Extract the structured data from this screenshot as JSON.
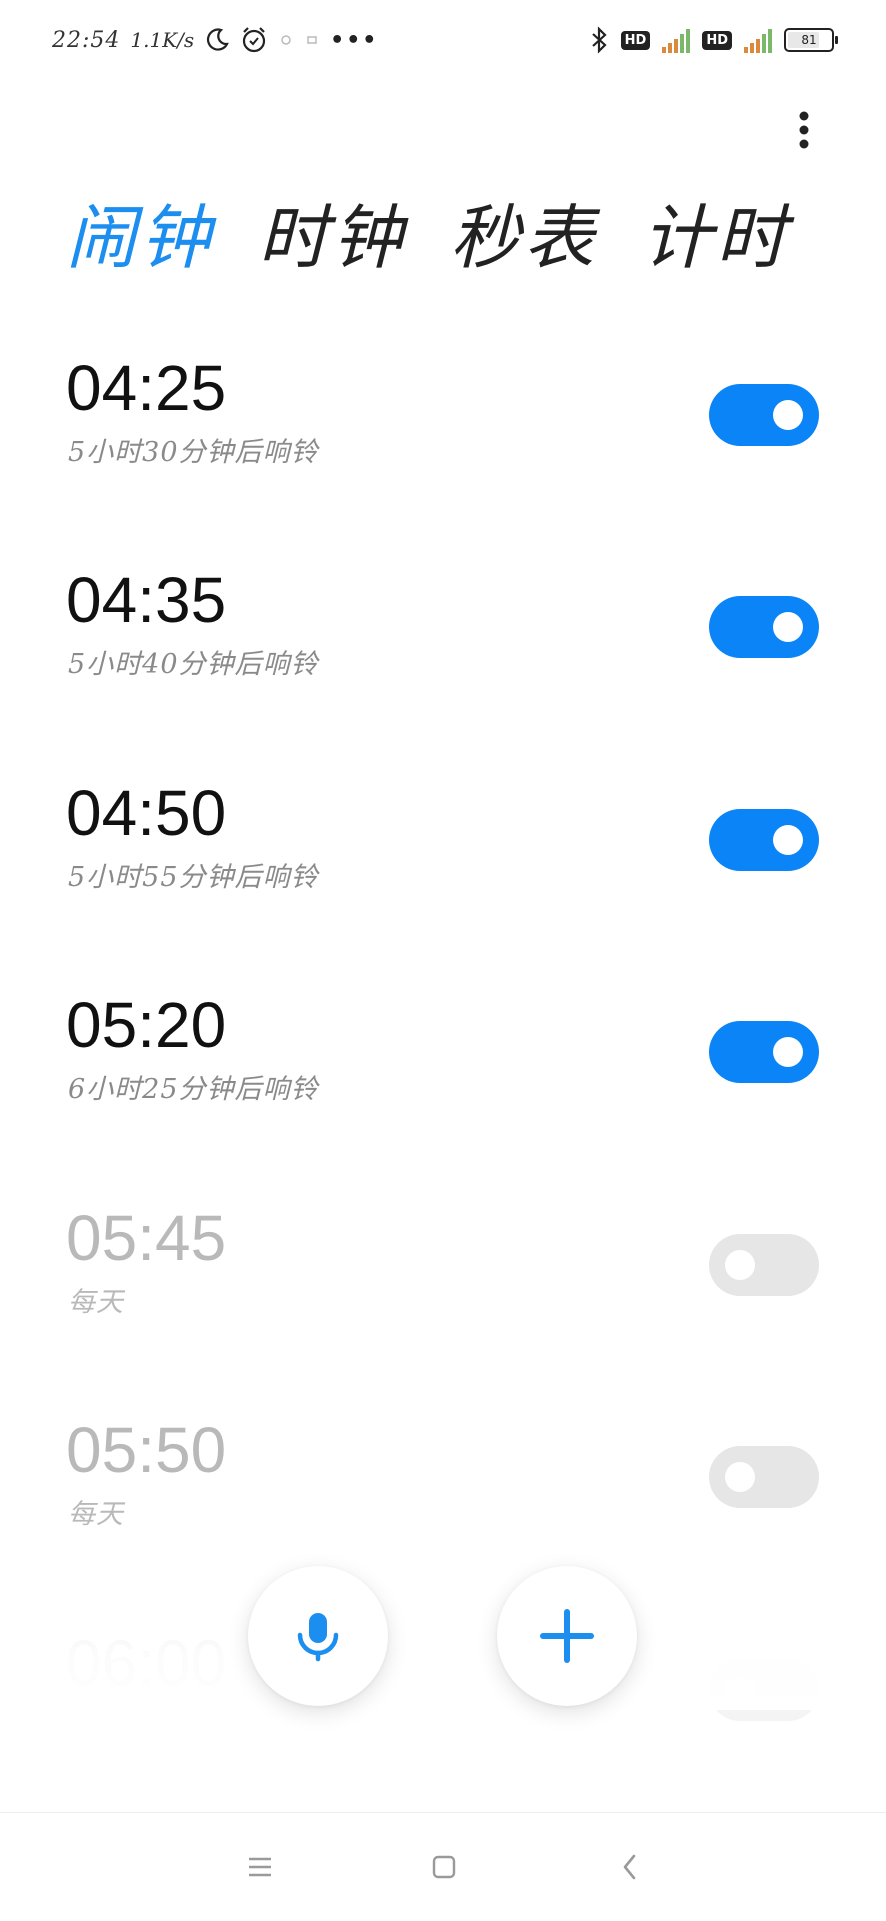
{
  "status_bar": {
    "time": "22:54",
    "net_speed": "1.1K/s",
    "more_dots": "•••",
    "hd_badges": [
      "HD",
      "HD"
    ],
    "battery_level": "81",
    "battery_fraction": 0.81
  },
  "tabs": [
    {
      "label": "闹钟",
      "active": true
    },
    {
      "label": "时钟",
      "active": false
    },
    {
      "label": "秒表",
      "active": false
    },
    {
      "label": "计时",
      "active": false
    }
  ],
  "alarms": [
    {
      "time": "04:25",
      "subtitle": "5小时30分钟后响铃",
      "enabled": true
    },
    {
      "time": "04:35",
      "subtitle": "5小时40分钟后响铃",
      "enabled": true
    },
    {
      "time": "04:50",
      "subtitle": "5小时55分钟后响铃",
      "enabled": true
    },
    {
      "time": "05:20",
      "subtitle": "6小时25分钟后响铃",
      "enabled": true
    },
    {
      "time": "05:45",
      "subtitle": "每天",
      "enabled": false
    },
    {
      "time": "05:50",
      "subtitle": "每天",
      "enabled": false
    },
    {
      "time": "06:00",
      "subtitle": "",
      "enabled": false
    }
  ],
  "colors": {
    "accent": "#0a84f7",
    "active_tab": "#1c8ef0",
    "toggle_off": "#e6e6e6",
    "disabled_text": "#b9b9b9"
  },
  "icons": {
    "voice_button": "microphone-icon",
    "add_button": "plus-icon",
    "more_button": "vertical-dots-icon",
    "nav": [
      "menu-icon",
      "home-icon",
      "back-icon"
    ]
  }
}
